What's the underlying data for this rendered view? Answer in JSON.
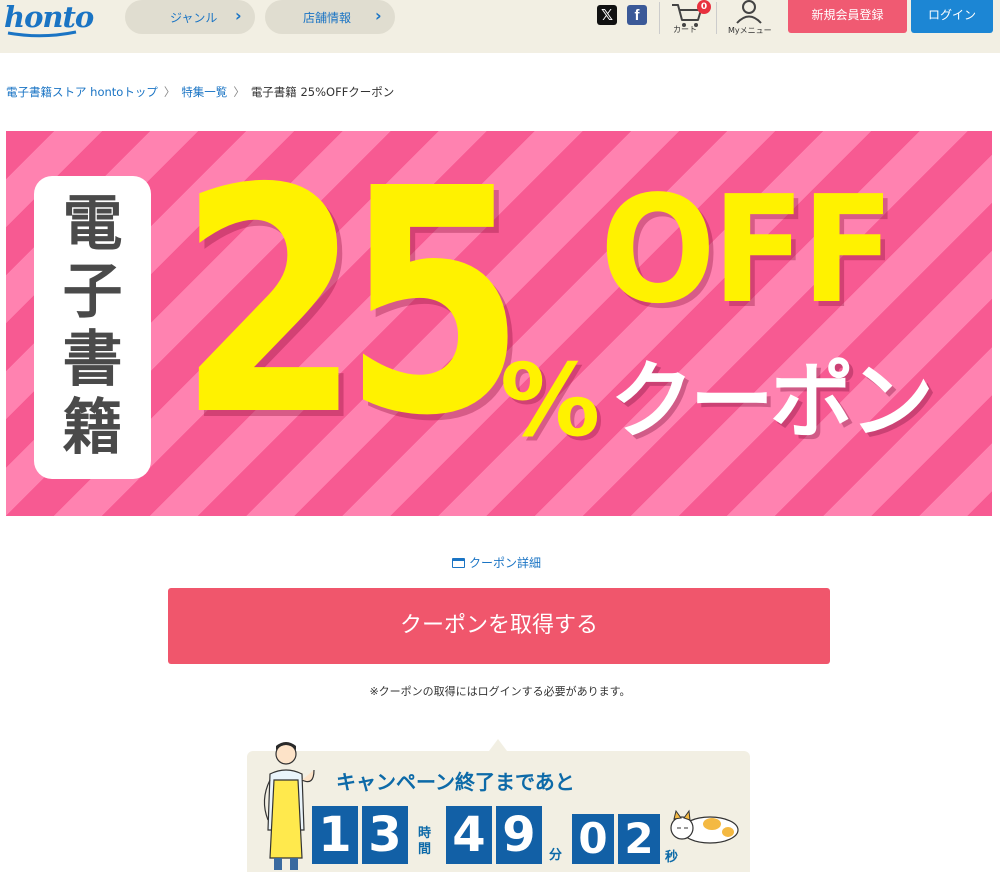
{
  "header": {
    "logo": "honto",
    "nav": [
      {
        "label": "ジャンル"
      },
      {
        "label": "店舗情報"
      }
    ],
    "cart_count": "0",
    "cart_label": "カート",
    "my_menu_label": "Myメニュー",
    "register_label": "新規会員登録",
    "login_label": "ログイン"
  },
  "breadcrumb": {
    "items": [
      "電子書籍ストア hontoトップ",
      "特集一覧"
    ],
    "current": "電子書籍 25%OFFクーポン"
  },
  "banner": {
    "vertical_text": "電子書籍",
    "big_number": "25",
    "percent": "%",
    "off": "OFF",
    "coupon": "クーポン"
  },
  "coupon": {
    "detail_link": "クーポン詳細",
    "get_button": "クーポンを取得する",
    "note": "※クーポンの取得にはログインする必要があります。"
  },
  "countdown": {
    "title": "キャンペーン終了まであと",
    "hours": [
      "1",
      "3"
    ],
    "hours_unit": "時間",
    "minutes": [
      "4",
      "9"
    ],
    "minutes_unit": "分",
    "seconds": [
      "0",
      "2"
    ],
    "seconds_unit": "秒"
  },
  "colors": {
    "brand_blue": "#1a74c4",
    "pink_button": "#f0566c",
    "banner_yellow": "#fff200",
    "header_bg": "#f2efe3"
  }
}
